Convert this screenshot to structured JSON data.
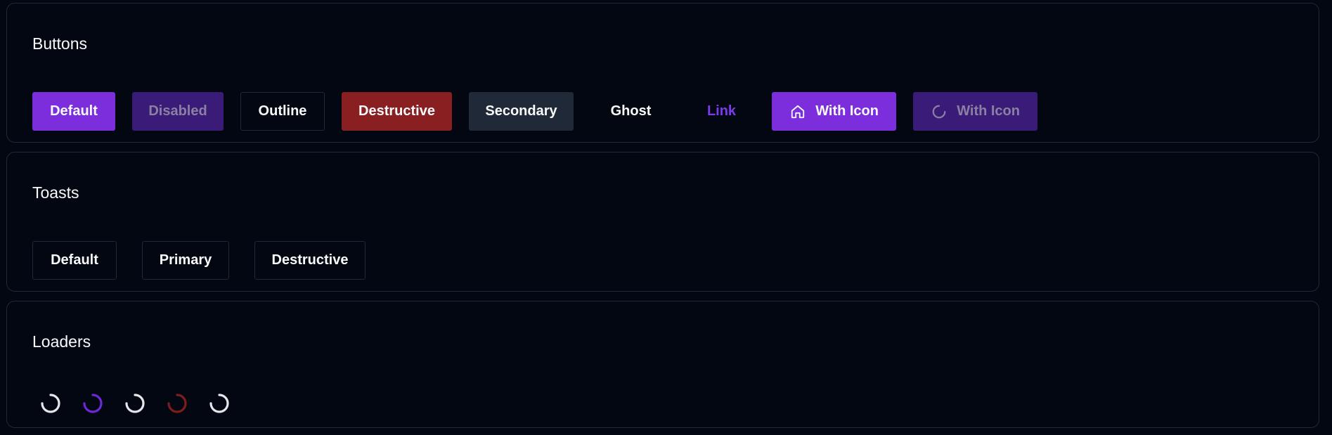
{
  "buttons_section": {
    "title": "Buttons",
    "buttons": {
      "default": "Default",
      "disabled": "Disabled",
      "outline": "Outline",
      "destructive": "Destructive",
      "secondary": "Secondary",
      "ghost": "Ghost",
      "link": "Link",
      "with_icon": "With Icon",
      "with_icon_loading": "With Icon"
    },
    "icons": {
      "with_icon": "home-icon",
      "with_icon_loading": "spinner-icon"
    }
  },
  "toasts_section": {
    "title": "Toasts",
    "buttons": {
      "default": "Default",
      "primary": "Primary",
      "destructive": "Destructive"
    }
  },
  "loaders_section": {
    "title": "Loaders",
    "loaders": [
      {
        "variant": "default",
        "color": "#e5e7eb"
      },
      {
        "variant": "primary",
        "color": "#6d28d9"
      },
      {
        "variant": "secondary",
        "color": "#e5e7eb"
      },
      {
        "variant": "destructive",
        "color": "#7f1d1d"
      },
      {
        "variant": "muted",
        "color": "#e5e7eb"
      }
    ]
  },
  "colors": {
    "background": "#030712",
    "border": "#1f2937",
    "primary": "#7c2edc",
    "destructive": "#8a1f22",
    "secondary": "#1f2937",
    "link": "#7c3aed"
  }
}
